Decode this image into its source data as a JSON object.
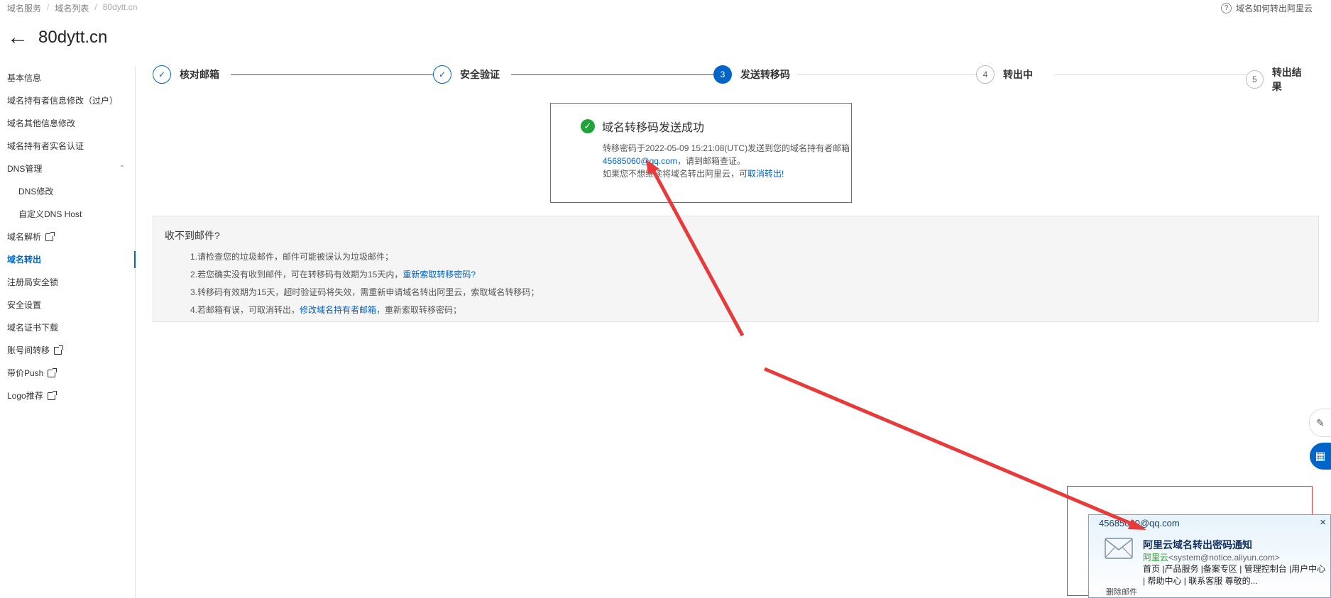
{
  "breadcrumb": [
    "域名服务",
    "域名列表",
    "80dytt.cn"
  ],
  "help_link": "域名如何转出阿里云",
  "title": "80dytt.cn",
  "sidebar": {
    "items": [
      {
        "label": "基本信息"
      },
      {
        "label": "域名持有者信息修改（过户）"
      },
      {
        "label": "域名其他信息修改"
      },
      {
        "label": "域名持有者实名认证"
      },
      {
        "label": "DNS管理"
      },
      {
        "label": "DNS修改"
      },
      {
        "label": "自定义DNS Host"
      },
      {
        "label": "域名解析"
      },
      {
        "label": "域名转出"
      },
      {
        "label": "注册局安全锁"
      },
      {
        "label": "安全设置"
      },
      {
        "label": "域名证书下载"
      },
      {
        "label": "账号间转移"
      },
      {
        "label": "带价Push"
      },
      {
        "label": "Logo推荐"
      }
    ]
  },
  "steps": [
    {
      "number": "✓",
      "label": "核对邮箱",
      "state": "done"
    },
    {
      "number": "✓",
      "label": "安全验证",
      "state": "done"
    },
    {
      "number": "3",
      "label": "发送转移码",
      "state": "current"
    },
    {
      "number": "4",
      "label": "转出中",
      "state": "todo"
    },
    {
      "number": "5",
      "label": "转出结果",
      "state": "todo"
    }
  ],
  "success": {
    "title": "域名转移码发送成功",
    "line1": "转移密码于2022-05-09 15:21:08(UTC)发送到您的域名持有者邮箱",
    "email": "45685060@qq.com",
    "line2_suffix": "，请到邮箱查证。",
    "line3_prefix": "如果您不想继续将域名转出阿里云，可",
    "cancel_link": "取消转出!"
  },
  "info": {
    "title": "收不到邮件?",
    "item1": "1.请检查您的垃圾邮件，邮件可能被误认为垃圾邮件；",
    "item2_prefix": "2.若您确实没有收到邮件，可在转移码有效期为15天内，",
    "item2_link": "重新索取转移密码?",
    "item3": "3.转移码有效期为15天，超时验证码将失效，需重新申请域名转出阿里云，索取域名转移码；",
    "item4_prefix": "4.若邮箱有误，可取消转出，",
    "item4_link": "修改域名持有者邮箱",
    "item4_suffix": "，重新索取转移密码；"
  },
  "notification": {
    "email": "45685060@qq.com",
    "close": "×",
    "subject": "阿里云域名转出密码通知",
    "sender_name": "阿里云",
    "sender_addr": "<system@notice.aliyun.com>",
    "body": "首页 |产品服务 |备案专区 | 管理控制台 |用户中心 | 帮助中心 | 联系客服 尊敬的...",
    "footer": "删除邮件"
  },
  "colors": {
    "accent": "#0064c8",
    "success": "#1fa43a",
    "annotation": "#e83a3a"
  },
  "icons": {
    "back": "arrow-left-icon",
    "help": "question-circle-icon",
    "ok": "check-circle-icon",
    "mail": "envelope-icon"
  }
}
